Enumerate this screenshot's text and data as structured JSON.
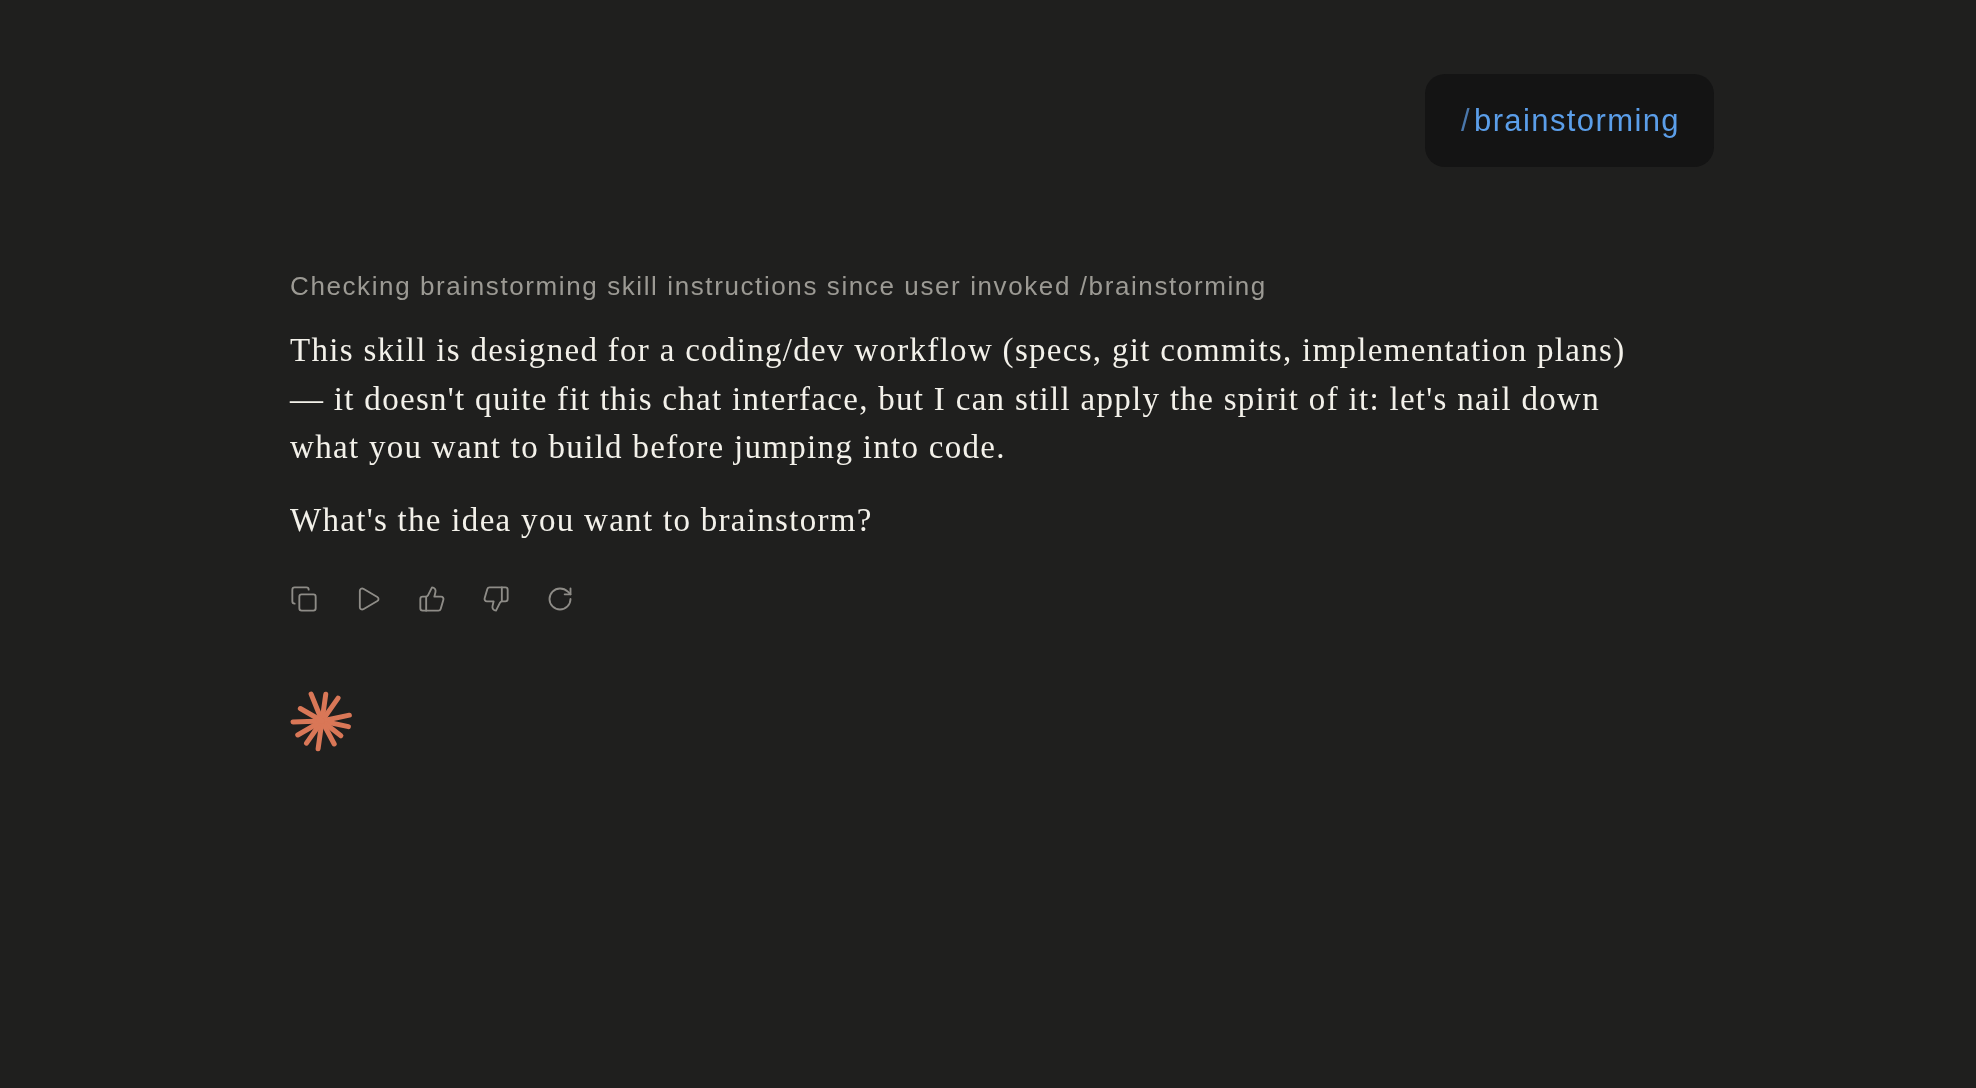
{
  "user_message": {
    "prefix": "/",
    "command": "brainstorming"
  },
  "assistant": {
    "status": "Checking brainstorming skill instructions since user invoked /brainstorming",
    "paragraphs": [
      "This skill is designed for a coding/dev workflow (specs, git commits, implementation plans) — it doesn't quite fit this chat interface, but I can still apply the spirit of it: let's nail down what you want to build before jumping into code.",
      "What's the idea you want to brainstorm?"
    ]
  }
}
